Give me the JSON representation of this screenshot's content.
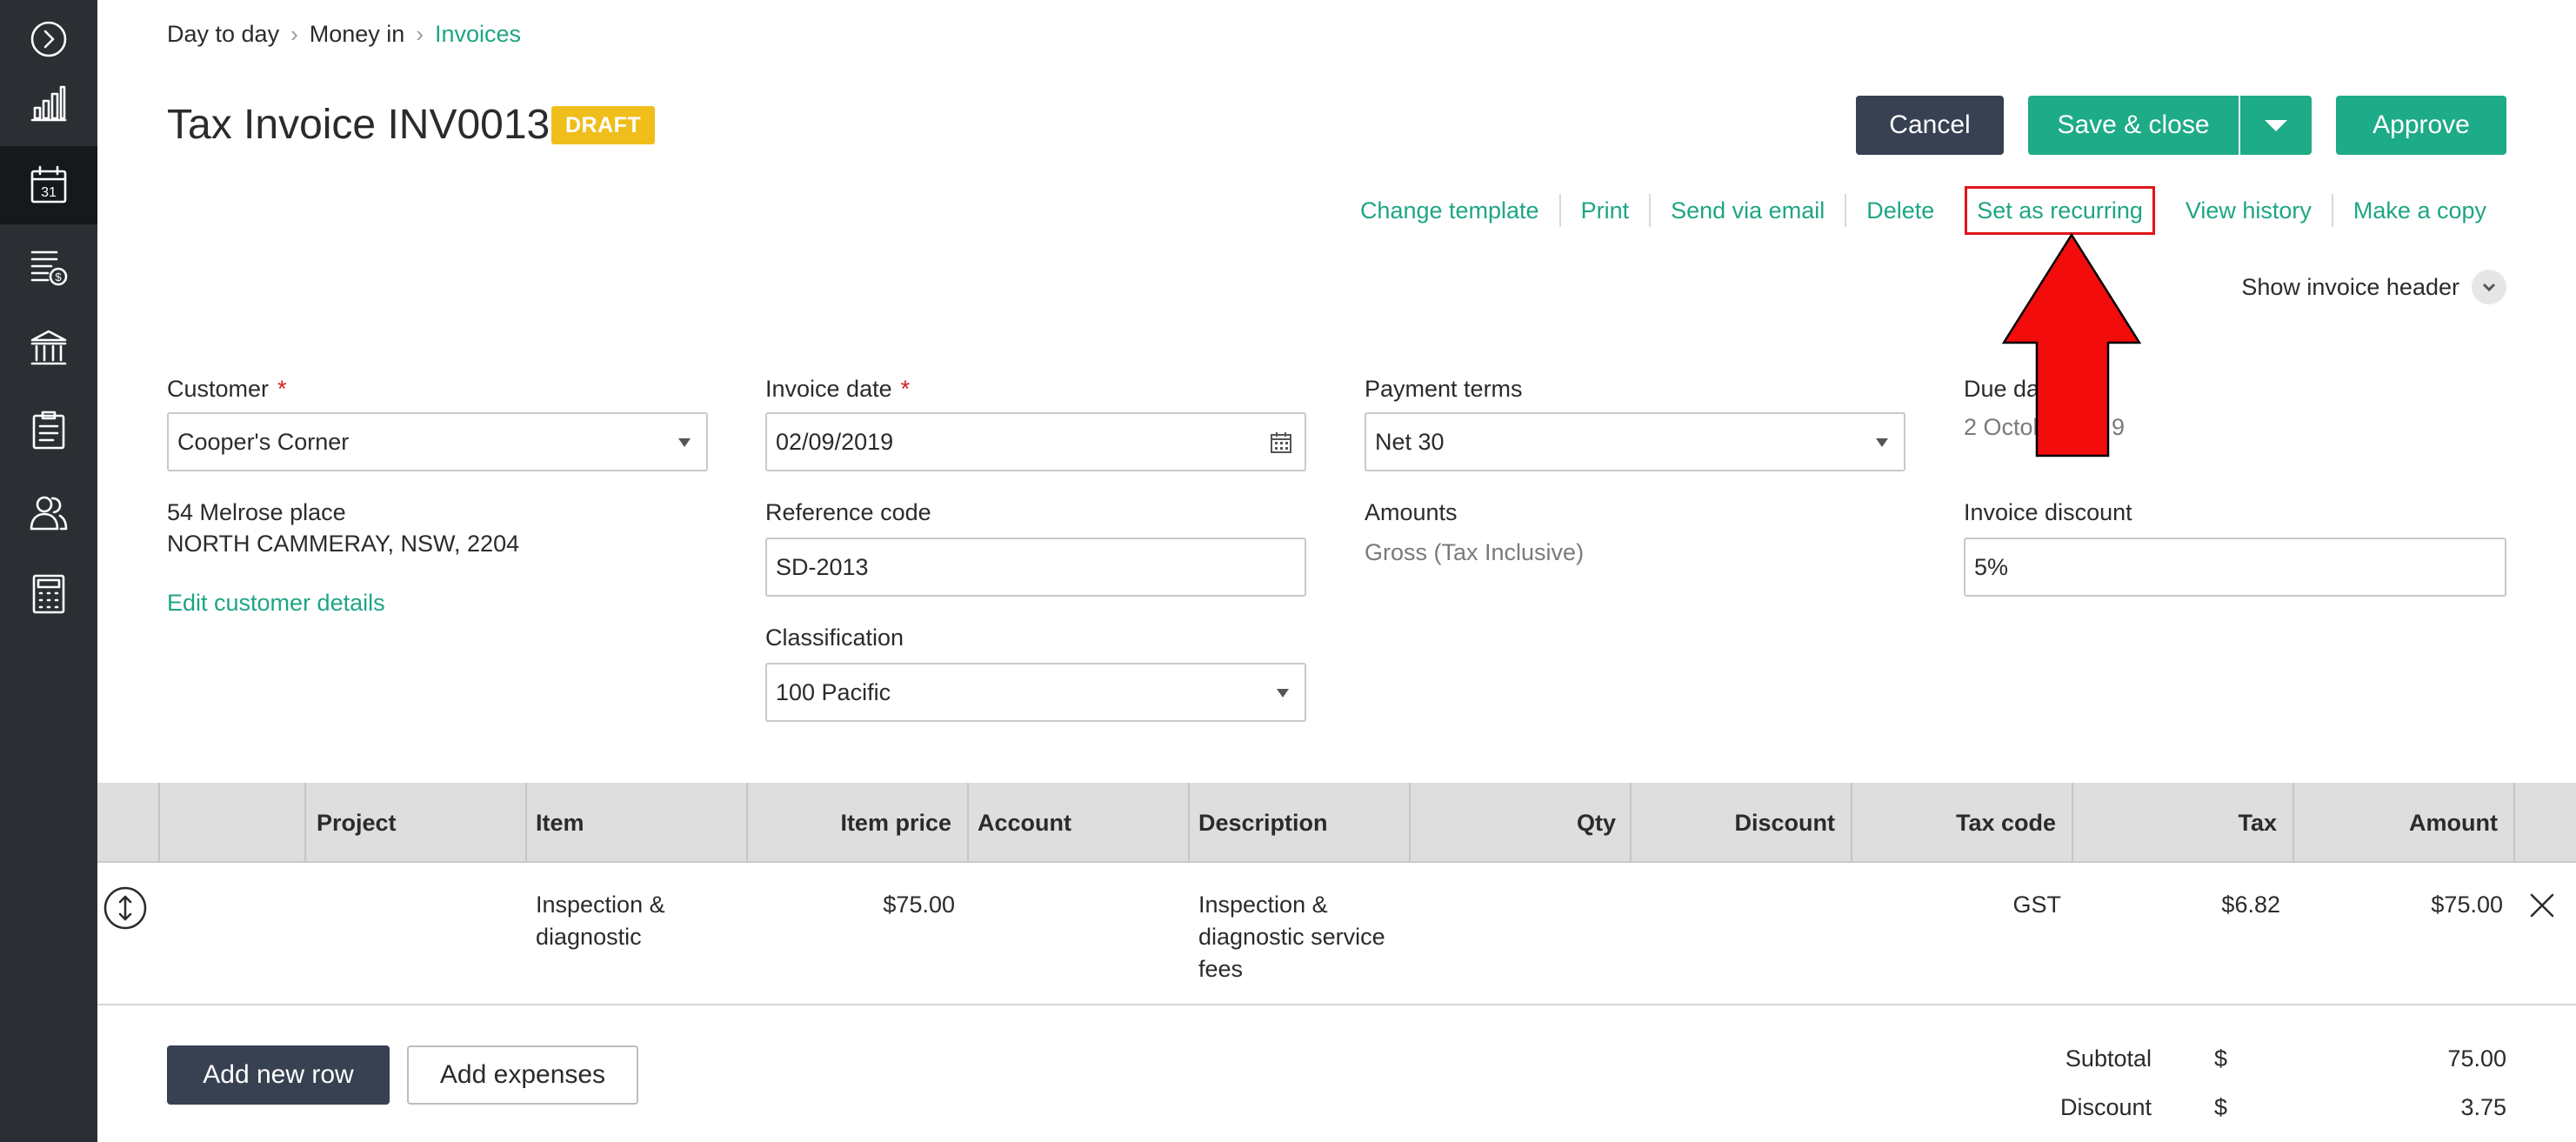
{
  "sidebar": {
    "items": [
      {
        "name": "expand-icon"
      },
      {
        "name": "reports-chart-icon"
      },
      {
        "name": "calendar-icon",
        "label": "31",
        "active": true
      },
      {
        "name": "sales-dollar-icon"
      },
      {
        "name": "banking-icon"
      },
      {
        "name": "clipboard-icon"
      },
      {
        "name": "contacts-icon"
      },
      {
        "name": "calculator-icon"
      }
    ]
  },
  "breadcrumb": {
    "items": [
      "Day to day",
      "Money in",
      "Invoices"
    ],
    "separator": "›"
  },
  "header": {
    "title": "Tax Invoice INV0013",
    "status_badge": "DRAFT"
  },
  "toolbar": {
    "cancel_label": "Cancel",
    "save_close_label": "Save & close",
    "approve_label": "Approve"
  },
  "actions": {
    "change_template": "Change template",
    "print": "Print",
    "send_via_email": "Send via email",
    "delete": "Delete",
    "set_as_recurring": "Set as recurring",
    "view_history": "View history",
    "make_a_copy": "Make a copy"
  },
  "show_invoice_header": "Show invoice header",
  "form": {
    "customer": {
      "label": "Customer",
      "required": "*",
      "value": "Cooper's Corner",
      "address_line1": "54 Melrose place",
      "address_line2": "NORTH CAMMERAY, NSW, 2204",
      "edit_link": "Edit customer details"
    },
    "invoice_date": {
      "label": "Invoice date",
      "required": "*",
      "value": "02/09/2019"
    },
    "reference_code": {
      "label": "Reference code",
      "value": "SD-2013"
    },
    "classification": {
      "label": "Classification",
      "value": "100 Pacific"
    },
    "payment_terms": {
      "label": "Payment terms",
      "value": "Net 30"
    },
    "amounts": {
      "label": "Amounts",
      "value": "Gross (Tax Inclusive)"
    },
    "due_date": {
      "label": "Due da",
      "value_start": "2 Octob",
      "value_end": "9"
    },
    "invoice_discount": {
      "label": "Invoice discount",
      "value": "5%"
    }
  },
  "table": {
    "headers": {
      "project": "Project",
      "item": "Item",
      "item_price": "Item price",
      "account": "Account",
      "description": "Description",
      "qty": "Qty",
      "discount": "Discount",
      "tax_code": "Tax code",
      "tax": "Tax",
      "amount": "Amount"
    },
    "rows": [
      {
        "item_line1": "Inspection &",
        "item_line2": "diagnostic",
        "item_price": "$75.00",
        "desc_line1": "Inspection &",
        "desc_line2": "diagnostic service",
        "desc_line3": "fees",
        "tax_code": "GST",
        "tax": "$6.82",
        "amount": "$75.00"
      }
    ]
  },
  "footer": {
    "add_new_row": "Add new row",
    "add_expenses": "Add expenses"
  },
  "totals": {
    "subtotal_label": "Subtotal",
    "subtotal_currency": "$",
    "subtotal_value": "75.00",
    "discount_label": "Discount",
    "discount_currency": "$",
    "discount_value": "3.75"
  },
  "colors": {
    "accent": "#1eab87",
    "sidebar": "#2b2f33",
    "badge": "#efbe1b",
    "highlight": "#e0141a"
  }
}
